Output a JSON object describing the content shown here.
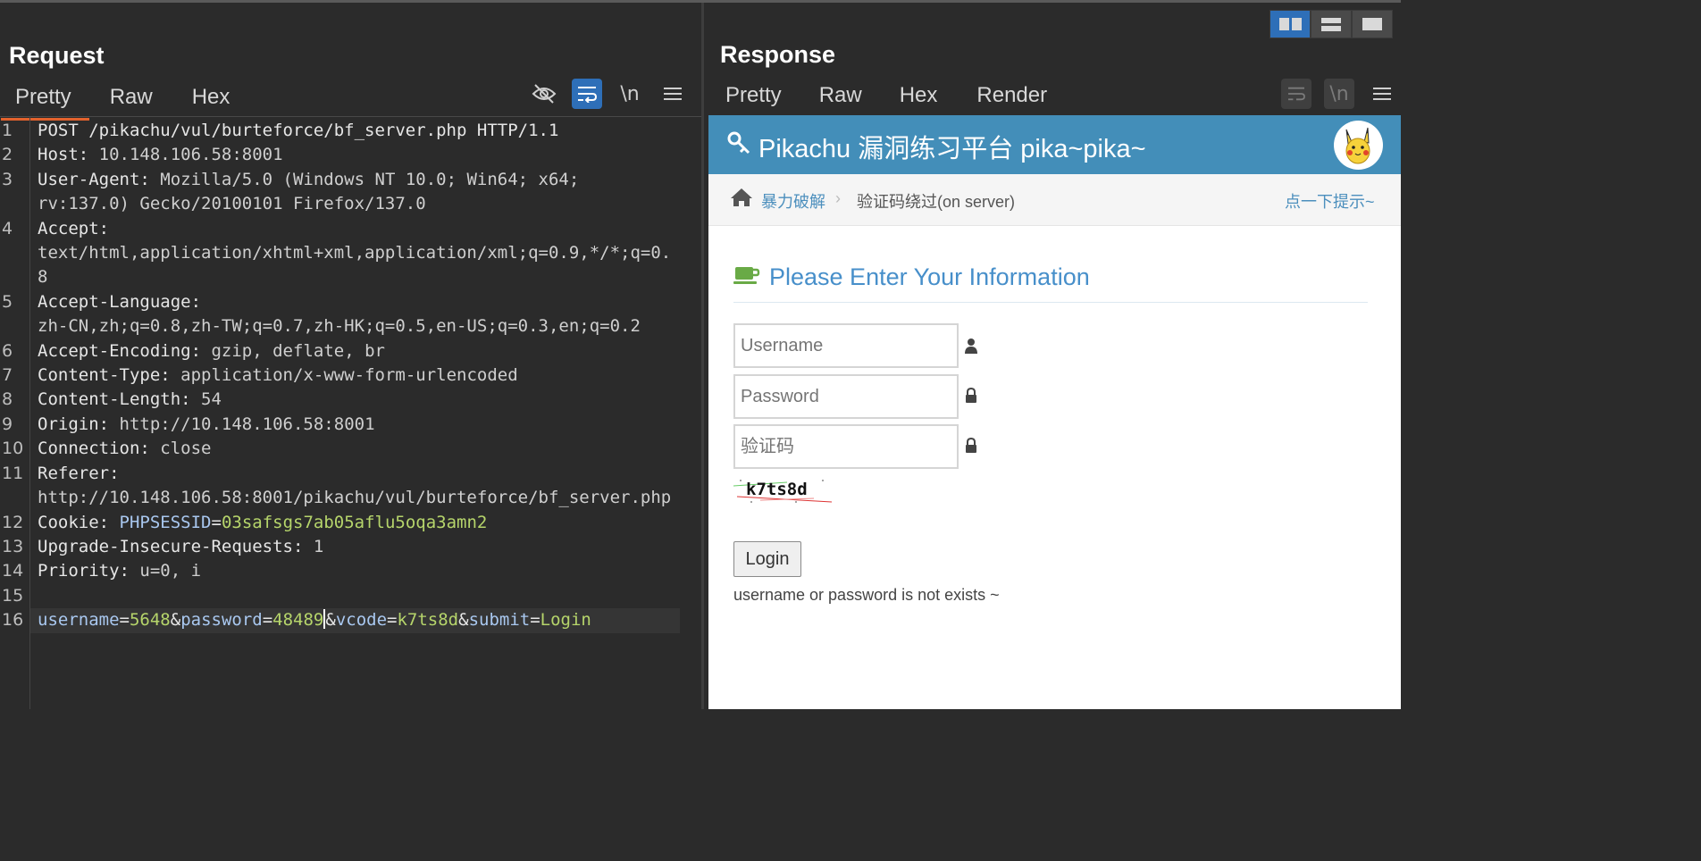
{
  "layout_buttons": [
    "side-by-side",
    "stacked",
    "single"
  ],
  "request": {
    "title": "Request",
    "tabs": [
      "Pretty",
      "Raw",
      "Hex"
    ],
    "active_tab": "Pretty",
    "icons": [
      "hide-icon",
      "wrap-icon",
      "newline-icon",
      "menu-icon"
    ],
    "newline_label": "\\n",
    "lines": [
      {
        "n": "1",
        "text": "POST /pikachu/vul/burteforce/bf_server.php HTTP/1.1"
      },
      {
        "n": "2",
        "key": "Host",
        "val": "10.148.106.58:8001"
      },
      {
        "n": "3",
        "key": "User-Agent",
        "val": "Mozilla/5.0 (Windows NT 10.0; Win64; x64;",
        "cont": "rv:137.0) Gecko/20100101 Firefox/137.0"
      },
      {
        "n": "4",
        "key": "Accept",
        "val": "",
        "cont": "text/html,application/xhtml+xml,application/xml;q=0.9,*/*;q=0.",
        "cont2": "8"
      },
      {
        "n": "5",
        "key": "Accept-Language",
        "val": "",
        "cont": "zh-CN,zh;q=0.8,zh-TW;q=0.7,zh-HK;q=0.5,en-US;q=0.3,en;q=0.2"
      },
      {
        "n": "6",
        "key": "Accept-Encoding",
        "val": "gzip, deflate, br"
      },
      {
        "n": "7",
        "key": "Content-Type",
        "val": "application/x-www-form-urlencoded"
      },
      {
        "n": "8",
        "key": "Content-Length",
        "val": "54"
      },
      {
        "n": "9",
        "key": "Origin",
        "val": "http://10.148.106.58:8001"
      },
      {
        "n": "10",
        "key": "Connection",
        "val": "close"
      },
      {
        "n": "11",
        "key": "Referer",
        "val": "",
        "cont": "http://10.148.106.58:8001/pikachu/vul/burteforce/bf_server.php"
      },
      {
        "n": "12",
        "key": "Cookie",
        "cookie_name": "PHPSESSID",
        "cookie_val": "03safsgs7ab05aflu5oqa3amn2"
      },
      {
        "n": "13",
        "key": "Upgrade-Insecure-Requests",
        "val": "1"
      },
      {
        "n": "14",
        "key": "Priority",
        "val": "u=0, i"
      },
      {
        "n": "15",
        "text": ""
      },
      {
        "n": "16",
        "body": [
          {
            "name": "username",
            "value": "5648"
          },
          {
            "name": "password",
            "value": "48489"
          },
          {
            "name": "vcode",
            "value": "k7ts8d"
          },
          {
            "name": "submit",
            "value": "Login"
          }
        ]
      }
    ]
  },
  "response": {
    "title": "Response",
    "tabs": [
      "Pretty",
      "Raw",
      "Hex",
      "Render"
    ],
    "active_tab": "Render",
    "render": {
      "site_title": "Pikachu 漏洞练习平台 pika~pika~",
      "breadcrumb_section": "暴力破解",
      "breadcrumb_current": "验证码绕过(on server)",
      "hint_link": "点一下提示~",
      "form_title": "Please Enter Your Information",
      "username_placeholder": "Username",
      "password_placeholder": "Password",
      "vcode_placeholder": "验证码",
      "captcha_text": "k7ts8d",
      "login_label": "Login",
      "message": "username or password is not exists ~"
    }
  },
  "colors": {
    "accent_blue": "#2e6fb8",
    "tab_underline": "#e2622d",
    "param_value": "#b6d56b",
    "param_name": "#a9c8f0",
    "site_header": "#438eb9"
  }
}
